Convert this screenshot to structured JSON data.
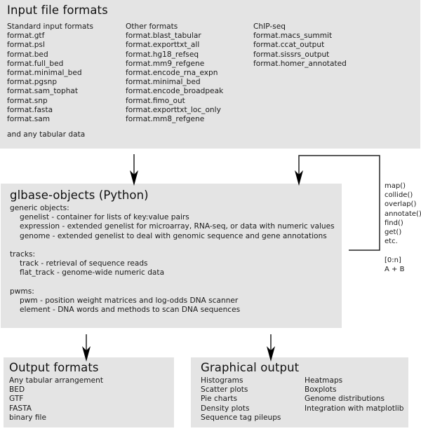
{
  "input_box": {
    "title": "Input file formats",
    "standard": {
      "header": "Standard input formats",
      "items": [
        "format.gtf",
        "format.psl",
        "format.bed",
        "format.full_bed",
        "format.minimal_bed",
        "format.pgsnp",
        "format.sam_tophat",
        "format.snp",
        "format.fasta",
        "format.sam"
      ]
    },
    "other": {
      "header": "Other formats",
      "items": [
        "format.blast_tabular",
        "format.exporttxt_all",
        "format.hg18_refseq",
        "format.mm9_refgene",
        "format.encode_rna_expn",
        "format.minimal_bed",
        "format.encode_broadpeak",
        "format.fimo_out",
        "format.exporttxt_loc_only",
        "format.mm8_refgene"
      ]
    },
    "chipseq": {
      "header": "ChIP-seq",
      "items": [
        "format.macs_summit",
        "format.ccat_output",
        "format.sissrs_output",
        "format.homer_annotated"
      ]
    },
    "footer": "and any tabular data"
  },
  "objects_box": {
    "title": "glbase-objects (Python)",
    "sections": [
      {
        "header": "generic objects:",
        "items": [
          "genelist - container for lists of key:value pairs",
          "expression - extended genelist for microarray, RNA-seq, or data with numeric values",
          "genome - extended genelist to deal with genomic sequence and gene annotations"
        ]
      },
      {
        "header": "tracks:",
        "items": [
          "track - retrieval of sequence reads",
          "flat_track - genome-wide numeric data"
        ]
      },
      {
        "header": "pwms:",
        "items": [
          "pwm - position weight matrices and log-odds DNA scanner",
          "element - DNA words and methods to scan DNA sequences"
        ]
      }
    ]
  },
  "methods": {
    "items": [
      "map()",
      "collide()",
      "overlap()",
      "annotate()",
      "find()",
      "get()",
      "etc."
    ],
    "extra": [
      "[0:n]",
      "A + B"
    ]
  },
  "output_box": {
    "title": "Output formats",
    "items": [
      "Any tabular arrangement",
      "BED",
      "GTF",
      "FASTA",
      "binary file"
    ]
  },
  "graphical_box": {
    "title": "Graphical output",
    "left": [
      "Histograms",
      "Scatter plots",
      "Pie charts",
      "Density plots",
      "Sequence tag pileups"
    ],
    "right": [
      "Heatmaps",
      "Boxplots",
      "Genome distributions",
      "Integration with matplotlib"
    ]
  }
}
